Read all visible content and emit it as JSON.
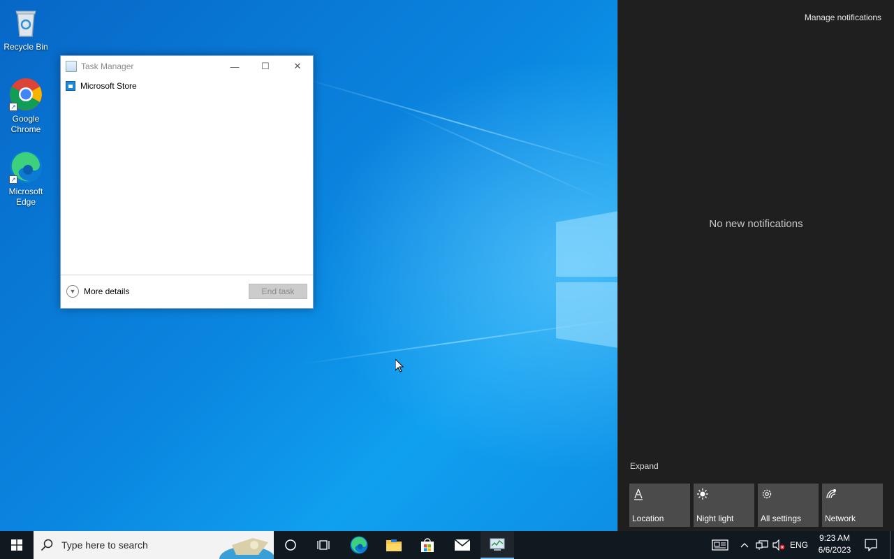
{
  "desktop": {
    "icons": [
      {
        "label": "Recycle Bin",
        "icon": "recycle-bin-icon"
      },
      {
        "label": "Google Chrome",
        "icon": "chrome-icon"
      },
      {
        "label": "Microsoft Edge",
        "icon": "edge-icon"
      }
    ]
  },
  "task_manager": {
    "title": "Task Manager",
    "apps": [
      {
        "name": "Microsoft Store",
        "icon": "store-icon"
      }
    ],
    "more_details_label": "More details",
    "end_task_label": "End task",
    "controls": {
      "minimize": "—",
      "maximize": "☐",
      "close": "✕"
    }
  },
  "action_center": {
    "manage_label": "Manage notifications",
    "empty_label": "No new notifications",
    "expand_label": "Expand",
    "quick_actions": [
      {
        "label": "Location",
        "icon": "location-icon",
        "glyph": "⛯"
      },
      {
        "label": "Night light",
        "icon": "night-light-icon",
        "glyph": "☀"
      },
      {
        "label": "All settings",
        "icon": "settings-gear-icon",
        "glyph": "⚙"
      },
      {
        "label": "Network",
        "icon": "network-icon",
        "glyph": "📶"
      }
    ]
  },
  "taskbar": {
    "search_placeholder": "Type here to search",
    "pinned": [
      {
        "name": "cortana",
        "icon": "cortana-circle-icon"
      },
      {
        "name": "task-view",
        "icon": "task-view-icon"
      },
      {
        "name": "edge",
        "icon": "edge-icon"
      },
      {
        "name": "file-explorer",
        "icon": "folder-icon"
      },
      {
        "name": "microsoft-store",
        "icon": "store-bag-icon"
      },
      {
        "name": "mail",
        "icon": "mail-icon"
      },
      {
        "name": "task-manager",
        "icon": "task-manager-icon",
        "active": true
      }
    ],
    "tray": {
      "language": "ENG",
      "time": "9:23 AM",
      "date": "6/6/2023"
    }
  }
}
